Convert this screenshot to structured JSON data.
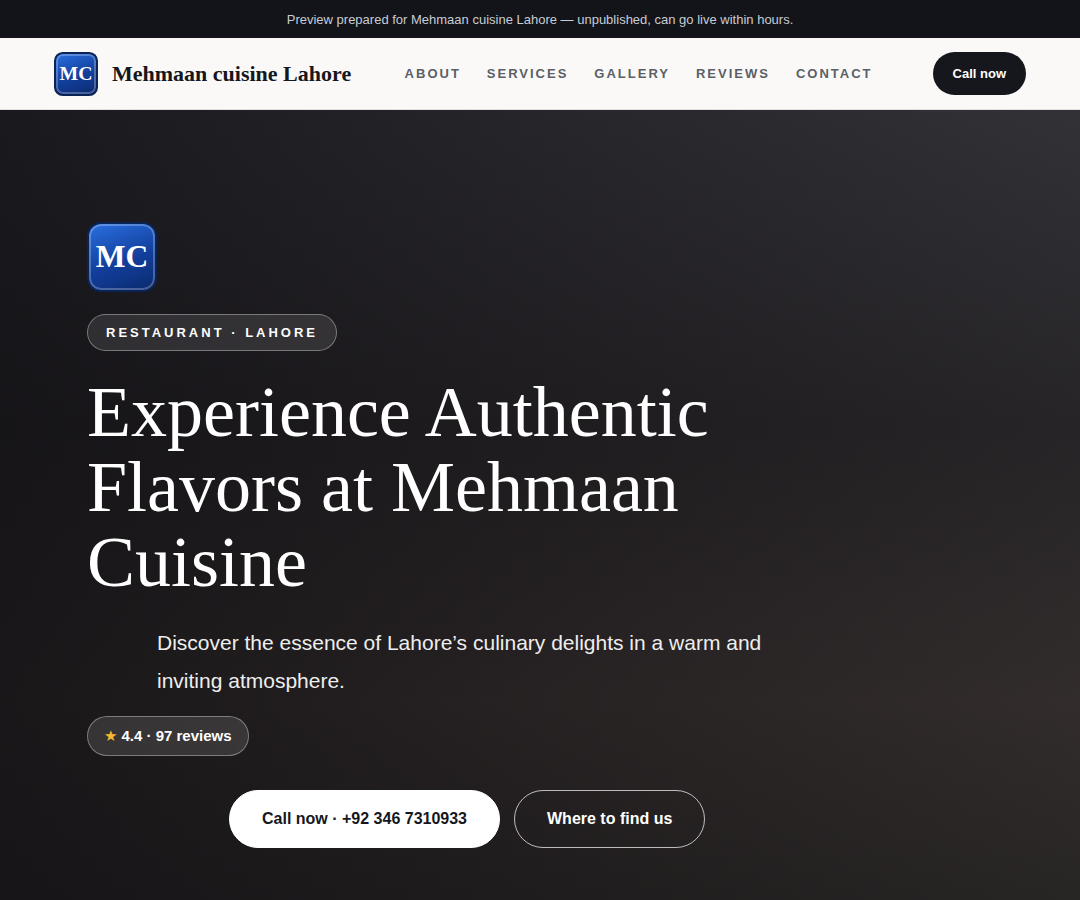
{
  "banner": {
    "text": "Preview prepared for Mehmaan cuisine Lahore — unpublished, can go live within hours."
  },
  "nav": {
    "logo": "MC",
    "brand": "Mehmaan cuisine Lahore",
    "links": [
      "ABOUT",
      "SERVICES",
      "GALLERY",
      "REVIEWS",
      "CONTACT"
    ],
    "cta": "Call now"
  },
  "hero": {
    "logo": "MC",
    "badge": "RESTAURANT · LAHORE",
    "title": "Experience Authentic Flavors at Mehmaan Cuisine",
    "subtitle": "Discover the essence of Lahore’s culinary delights in a warm and inviting atmosphere.",
    "rating": {
      "star": "★",
      "text": "4.4 · 97 reviews"
    },
    "buttons": [
      {
        "label": "Call now · +92 346 7310933",
        "kind": "primary"
      },
      {
        "label": "Where to find us",
        "kind": "outline"
      }
    ]
  }
}
